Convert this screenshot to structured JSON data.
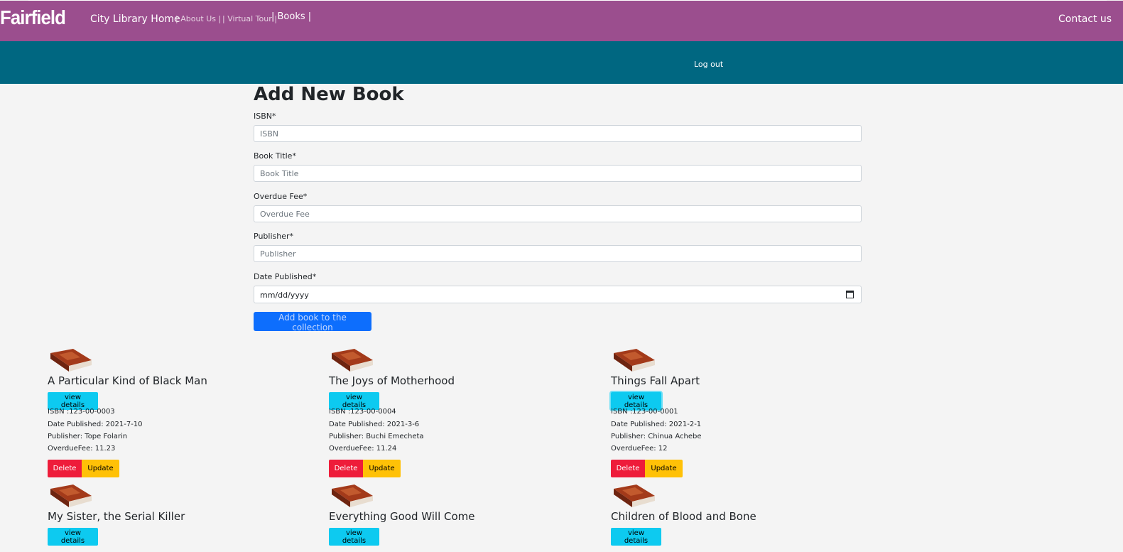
{
  "nav": {
    "brand": "Fairfield",
    "home": "City Library Home",
    "about": "| About Us |",
    "tour": "| Virtual Tour |",
    "books": "| Books |",
    "contact": "Contact us",
    "logout": "Log out"
  },
  "form": {
    "title": "Add New Book",
    "isbn_label": "ISBN*",
    "isbn_placeholder": "ISBN",
    "title_label": "Book Title*",
    "title_placeholder": "Book Title",
    "fee_label": "Overdue Fee*",
    "fee_placeholder": "Overdue Fee",
    "publisher_label": "Publisher*",
    "publisher_placeholder": "Publisher",
    "date_label": "Date Published*",
    "date_placeholder": "mm/dd/yyyy",
    "submit": "Add book to the collection"
  },
  "books": [
    {
      "title": "A Particular Kind of Black Man",
      "view": "view details",
      "isbn": "ISBN :123-00-0003",
      "date": "Date Published: 2021-7-10",
      "publisher": "Publisher: Tope Folarin",
      "fee": "OverdueFee: 11.23",
      "delete": "Delete",
      "update": "Update"
    },
    {
      "title": "The Joys of Motherhood",
      "view": "view details",
      "isbn": "ISBN :123-00-0004",
      "date": "Date Published: 2021-3-6",
      "publisher": "Publisher: Buchi Emecheta",
      "fee": "OverdueFee: 11.24",
      "delete": "Delete",
      "update": "Update"
    },
    {
      "title": "Things Fall Apart",
      "view": "view details",
      "isbn": "ISBN :123-00-0001",
      "date": "Date Published: 2021-2-1",
      "publisher": "Publisher: Chinua Achebe",
      "fee": "OverdueFee: 12",
      "delete": "Delete",
      "update": "Update"
    },
    {
      "title": "My Sister, the Serial Killer",
      "view": "view details"
    },
    {
      "title": "Everything Good Will Come",
      "view": "view details"
    },
    {
      "title": "Children of Blood and Bone",
      "view": "view details"
    }
  ]
}
